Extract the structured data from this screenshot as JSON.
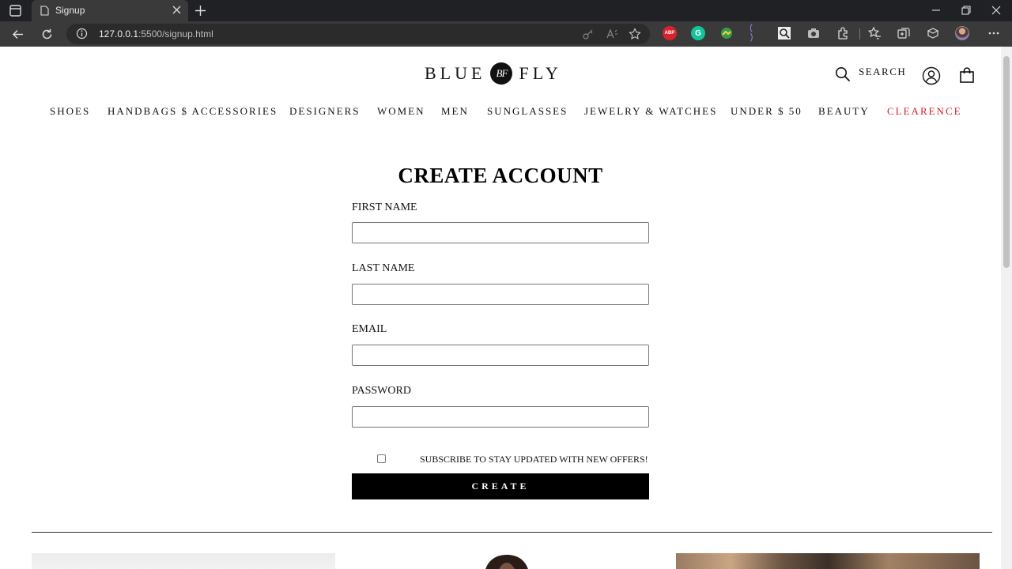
{
  "browser": {
    "tab_title": "Signup",
    "url_host": "127.0.0.1",
    "url_rest": ":5500/signup.html",
    "extensions": [
      {
        "name": "adblock-plus",
        "color": "#d9232c",
        "label": "ABP"
      },
      {
        "name": "grammarly",
        "color": "#15c39a",
        "label": "G"
      },
      {
        "name": "extension-green",
        "color": "#3a9b46",
        "label": ""
      },
      {
        "name": "extension-brackets",
        "color": "#7a4fd1",
        "label": "( )"
      },
      {
        "name": "extension-search",
        "color": "#dcdcdc",
        "label": ""
      },
      {
        "name": "extension-camera",
        "color": "#bbbbbb",
        "label": ""
      }
    ]
  },
  "header": {
    "logo_left": "BLUE",
    "logo_badge": "BF",
    "logo_right": "FLY",
    "search_label": "SEARCH"
  },
  "nav": {
    "items": [
      "SHOES",
      "HANDBAGS $ ACCESSORIES",
      "DESIGNERS",
      "WOMEN",
      "MEN",
      "SUNGLASSES",
      "JEWELRY & WATCHES",
      "UNDER $ 50",
      "BEAUTY",
      "CLEARENCE"
    ],
    "highlight_color": "#d21f2b"
  },
  "form": {
    "title": "CREATE ACCOUNT",
    "first_name_label": "FIRST NAME",
    "first_name_value": "",
    "last_name_label": "LAST NAME",
    "last_name_value": "",
    "email_label": "EMAIL",
    "email_value": "",
    "password_label": "PASSWORD",
    "password_value": "",
    "subscribe_label": "SUBSCRIBE TO STAY UPDATED WITH NEW OFFERS!",
    "subscribe_checked": false,
    "submit_label": "CREATE"
  }
}
